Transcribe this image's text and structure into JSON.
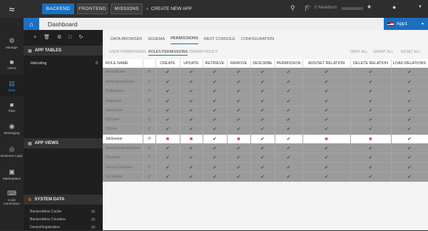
{
  "topbar": {
    "nav": [
      "BACKEND",
      "FRONTEND",
      "MISSIONS"
    ],
    "create_app": "CREATE NEW APP",
    "level": "0   Newborn",
    "progress_fraction": 0.0
  },
  "leftnav": [
    {
      "icon": "gear",
      "label": "Manage"
    },
    {
      "icon": "users",
      "label": "Users"
    },
    {
      "icon": "data",
      "label": "Data"
    },
    {
      "icon": "files",
      "label": "Files"
    },
    {
      "icon": "messaging",
      "label": "Messaging"
    },
    {
      "icon": "business-logic",
      "label": "Business Logic"
    },
    {
      "icon": "marketplace",
      "label": "Marketplace"
    },
    {
      "icon": "code-generation",
      "label": "Code Generation"
    }
  ],
  "header": {
    "title": "Dashboard",
    "app_name": "App1"
  },
  "tablepanel": {
    "app_tables_label": "APP TABLES",
    "tables": [
      {
        "name": "JobListing",
        "count": "0"
      }
    ],
    "app_views_label": "APP VIEWS",
    "system_data_label": "SYSTEM DATA",
    "system": [
      {
        "name": "Backendless Cache",
        "count": "0"
      },
      {
        "name": "Backendless Counters",
        "count": "0"
      },
      {
        "name": "DeviceRegistration",
        "count": "0"
      }
    ]
  },
  "main": {
    "subtabs": [
      "DATA BROWSER",
      "SCHEMA",
      "PERMISSIONS",
      "REST CONSOLE",
      "CONFIGURATION"
    ],
    "perm_tabs": [
      "USER PERMISSIONS",
      "ROLES PERMISSIONS",
      "OWNER POLICY"
    ],
    "actions": [
      "DENY ALL",
      "GRANT ALL",
      "RESET ALL"
    ],
    "columns": [
      "ROLE NAME",
      "",
      "CREATE",
      "UPDATE",
      "RETRIEVE",
      "REMOVE",
      "DESCRIBE",
      "PERMISSION",
      "ADD/SET RELATION",
      "DELETE RELATION",
      "LOAD RELATIONS"
    ],
    "roles": [
      {
        "name": "AndroidUser",
        "values": [
          "✔",
          "✔",
          "✔",
          "✔",
          "✔",
          "✔",
          "✔",
          "✔",
          "✔"
        ]
      },
      {
        "name": "AuthenticatedUser",
        "values": [
          "✔",
          "✔",
          "✔",
          "✔",
          "✔",
          "✔",
          "✔",
          "✔",
          "✔"
        ]
      },
      {
        "name": "DotNetUser",
        "values": [
          "✔",
          "✔",
          "✔",
          "✔",
          "✔",
          "✔",
          "✔",
          "✔",
          "✔"
        ]
      },
      {
        "name": "Employee",
        "values": [
          "✔",
          "✔",
          "✔",
          "✔",
          "✔",
          "✔",
          "✔",
          "✔",
          "✔"
        ]
      },
      {
        "name": "GuestUser",
        "values": [
          "✔",
          "✔",
          "✔",
          "✔",
          "✔",
          "✔",
          "✔",
          "✔",
          "✔"
        ]
      },
      {
        "name": "IOSUser",
        "values": [
          "✔",
          "✔",
          "✔",
          "✔",
          "✔",
          "✔",
          "✔",
          "✔",
          "✔"
        ]
      },
      {
        "name": "JSUser",
        "values": [
          "✔",
          "✔",
          "✔",
          "✔",
          "✔",
          "✔",
          "✔",
          "✔",
          "✔"
        ]
      },
      {
        "name": "JobSeeker",
        "values": [
          "✖",
          "✖",
          "✔",
          "✖",
          "✔",
          "✔",
          "✖",
          "✖",
          "✔"
        ],
        "highlight": true
      },
      {
        "name": "NotAuthenticatedUser",
        "values": [
          "✔",
          "✔",
          "✔",
          "✔",
          "✔",
          "✔",
          "✔",
          "✔",
          "✔"
        ]
      },
      {
        "name": "RestUser",
        "values": [
          "✔",
          "✔",
          "✔",
          "✔",
          "✔",
          "✔",
          "✔",
          "✔",
          "✔"
        ]
      },
      {
        "name": "ServerCodeUser",
        "values": [
          "✔",
          "✔",
          "✔",
          "✔",
          "✔",
          "✔",
          "✔",
          "✔",
          "✔"
        ]
      },
      {
        "name": "SocialUser",
        "values": [
          "✔",
          "✔",
          "✔",
          "✔",
          "✔",
          "✔",
          "✔",
          "✔",
          "✔"
        ]
      }
    ]
  }
}
